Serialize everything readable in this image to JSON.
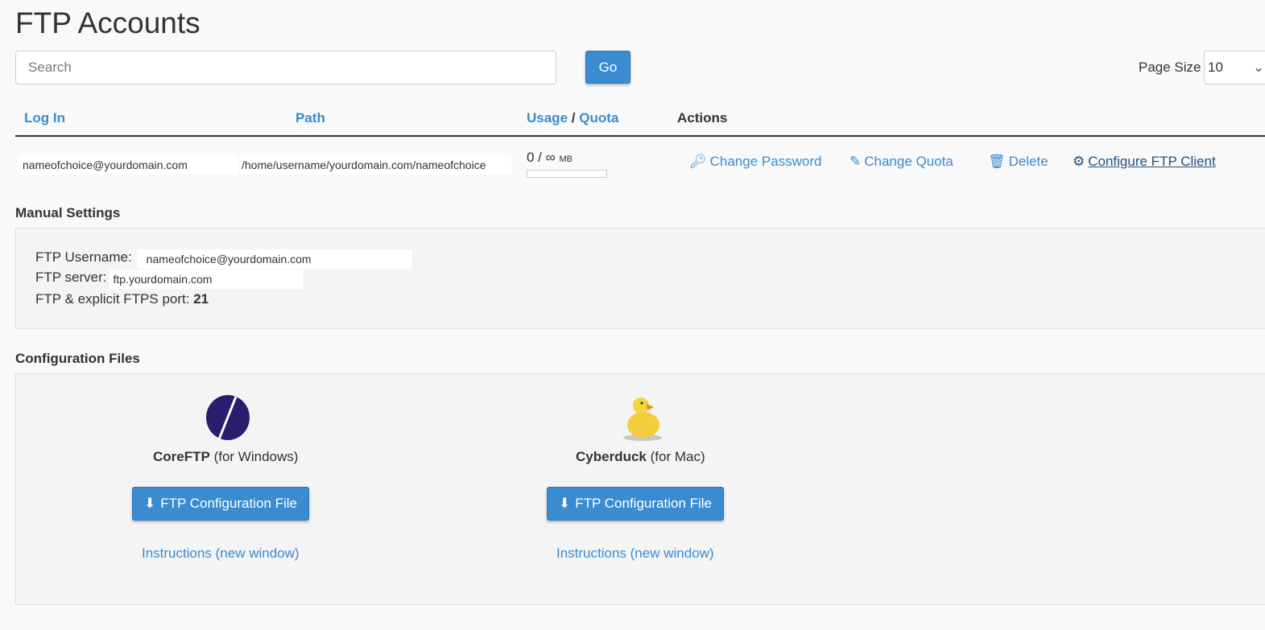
{
  "page": {
    "title": "FTP Accounts"
  },
  "search": {
    "placeholder": "Search",
    "go_label": "Go",
    "page_size_label": "Page Size",
    "page_size_value": "10"
  },
  "table": {
    "headers": {
      "login": "Log In",
      "path": "Path",
      "usage": "Usage",
      "slash": "/",
      "quota": "Quota",
      "actions": "Actions"
    },
    "rows": [
      {
        "login": "nameofchoice@yourdomain.com",
        "path": "/home/username/yourdomain.com/nameofchoice",
        "usage": "0 / ∞",
        "unit": "MB",
        "usage_fraction": 0,
        "actions": [
          "Change Password",
          "Change Quota",
          "Delete",
          "Configure FTP Client"
        ]
      }
    ]
  },
  "manual": {
    "title": "Manual Settings",
    "username_label": "FTP Username:",
    "username": "nameofchoice@yourdomain.com",
    "server_label": "FTP server:",
    "server": "ftp.yourdomain.com",
    "port_label": "FTP & explicit FTPS port:",
    "port": "21"
  },
  "config": {
    "title": "Configuration Files",
    "clients": [
      {
        "name": "CoreFTP",
        "platform": "(for Windows)",
        "button": "FTP Configuration File",
        "instructions": "Instructions (new window)"
      },
      {
        "name": "Cyberduck",
        "platform": "(for Mac)",
        "button": "FTP Configuration File",
        "instructions": "Instructions (new window)"
      }
    ]
  },
  "colors": {
    "accent": "#3a8bd0",
    "coreftp": "#2b1d6e",
    "duck": "#f2cf3a"
  }
}
